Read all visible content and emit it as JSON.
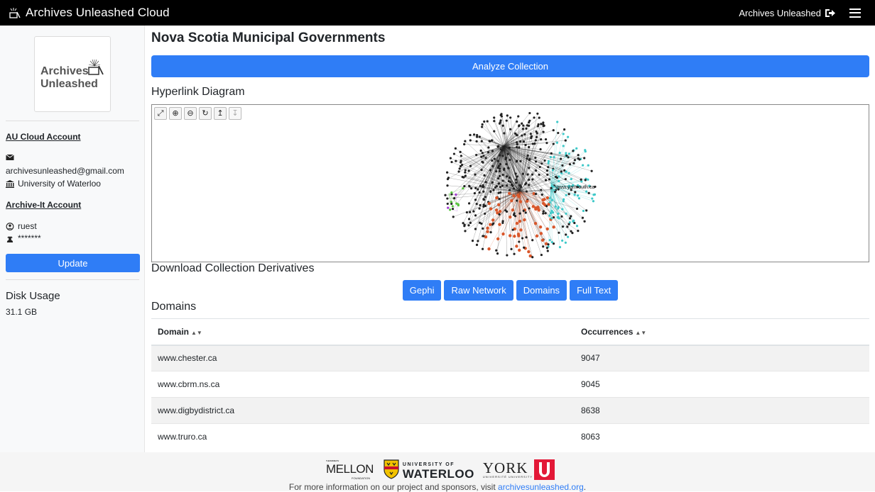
{
  "app": {
    "title": "Archives Unleashed Cloud",
    "user_link": "Archives Unleashed",
    "icons": {
      "brand": "archive-fan-icon",
      "logout": "sign-out-icon",
      "menu": "hamburger-menu-icon"
    }
  },
  "sidebar": {
    "logo_line1": "Archives",
    "logo_line2": "Unleashed",
    "au_heading": "AU Cloud Account",
    "email": "archivesunleashed@gmail.com",
    "institution": "University of Waterloo",
    "ai_heading": "Archive-It Account",
    "ai_user": "ruest",
    "ai_password": "*******",
    "update_label": "Update",
    "disk_title": "Disk Usage",
    "disk_value": "31.1 GB"
  },
  "main": {
    "title": "Nova Scotia Municipal Governments",
    "analyze_label": "Analyze Collection",
    "graph_title": "Hyperlink Diagram",
    "graph_label": "www.yarmouth.ca",
    "graph_tools": [
      "expand-icon",
      "zoom-in-icon",
      "zoom-out-icon",
      "refresh-icon",
      "up-arrow-icon",
      "down-arrow-icon"
    ],
    "graph_colors": {
      "black": "#222222",
      "orange": "#d9572b",
      "cyan": "#3ec9c9",
      "green": "#55c43a",
      "purple": "#a23bd1"
    },
    "derivatives_title": "Download Collection Derivatives",
    "derivatives": [
      "Gephi",
      "Raw Network",
      "Domains",
      "Full Text"
    ],
    "domains_title": "Domains",
    "table": {
      "headers": [
        "Domain",
        "Occurrences"
      ],
      "sort_glyph": "▲▼",
      "rows": [
        [
          "www.chester.ca",
          "9047"
        ],
        [
          "www.cbrm.ns.ca",
          "9045"
        ],
        [
          "www.digbydistrict.ca",
          "8638"
        ],
        [
          "www.truro.ca",
          "8063"
        ]
      ]
    }
  },
  "footer": {
    "mellon_small": "THE ANDREW W.",
    "mellon": "MELLON",
    "mellon_foundation": "FOUNDATION",
    "waterloo_top": "UNIVERSITY OF",
    "waterloo": "WATERLOO",
    "york": "YORK",
    "york_sub": "UNIVERSITÉ UNIVERSITY",
    "text": "For more information on our project and sponsors, visit ",
    "link": "archivesunleashed.org",
    "text_end": "."
  }
}
